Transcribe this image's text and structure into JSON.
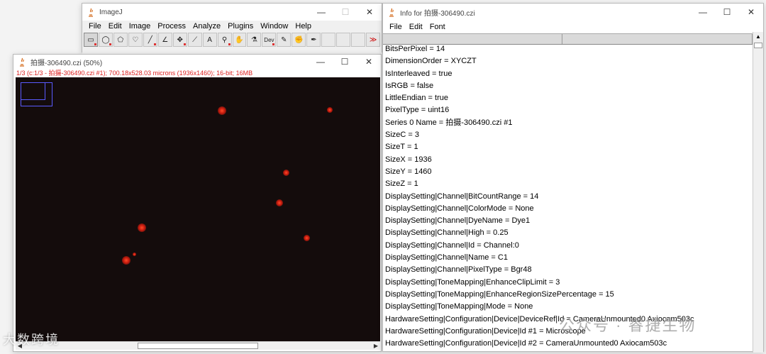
{
  "imagej": {
    "title": "ImageJ",
    "menus": [
      "File",
      "Edit",
      "Image",
      "Process",
      "Analyze",
      "Plugins",
      "Window",
      "Help"
    ],
    "tools": [
      {
        "name": "rectangle-tool-icon",
        "glyph": "▭",
        "selected": true,
        "flag": true
      },
      {
        "name": "oval-tool-icon",
        "glyph": "◯",
        "flag": true
      },
      {
        "name": "polygon-tool-icon",
        "glyph": "⬠",
        "flag": false
      },
      {
        "name": "freehand-tool-icon",
        "glyph": "♡",
        "flag": false
      },
      {
        "name": "line-tool-icon",
        "glyph": "╱",
        "flag": true
      },
      {
        "name": "angle-tool-icon",
        "glyph": "∠",
        "flag": false
      },
      {
        "name": "point-tool-icon",
        "glyph": "✥",
        "flag": true
      },
      {
        "name": "wand-tool-icon",
        "glyph": "⟋",
        "flag": false
      },
      {
        "name": "text-tool-icon",
        "glyph": "A",
        "flag": false
      },
      {
        "name": "magnifier-tool-icon",
        "glyph": "⚲",
        "flag": true
      },
      {
        "name": "hand-tool-icon",
        "glyph": "✋",
        "flag": false
      },
      {
        "name": "dropper-tool-icon",
        "glyph": "⚗",
        "flag": false
      },
      {
        "name": "dev-tool-icon",
        "glyph": "Dev",
        "flag": true
      },
      {
        "name": "brush-tool-icon",
        "glyph": "✎",
        "flag": false
      },
      {
        "name": "flood-fill-tool-icon",
        "glyph": "✊",
        "flag": false
      },
      {
        "name": "pencil-tool-icon",
        "glyph": "✒",
        "flag": false
      },
      {
        "name": "empty-tool-slot",
        "glyph": "",
        "flag": false
      },
      {
        "name": "empty-tool-slot",
        "glyph": "",
        "flag": false
      },
      {
        "name": "empty-tool-slot",
        "glyph": "",
        "flag": false
      },
      {
        "name": "more-tools-icon",
        "glyph": "≫",
        "flag": false
      }
    ]
  },
  "image_window": {
    "title": "拍摄-306490.czi (50%)",
    "info": "1/3 (c:1/3 - 拍摄-306490.czi #1); 700.18x528.03 microns (1936x1460); 16-bit; 16MB"
  },
  "info_window": {
    "title": "Info for 拍摄-306490.czi",
    "menus": [
      "File",
      "Edit",
      "Font"
    ],
    "lines": [
      " BitsPerPixel = 14",
      " DimensionOrder = XYCZT",
      " IsInterleaved = true",
      " IsRGB = false",
      " LittleEndian = true",
      " PixelType = uint16",
      " Series 0 Name = 拍摄-306490.czi #1",
      " SizeC = 3",
      " SizeT = 1",
      " SizeX = 1936",
      " SizeY = 1460",
      " SizeZ = 1",
      "DisplaySetting|Channel|BitCountRange = 14",
      "DisplaySetting|Channel|ColorMode = None",
      "DisplaySetting|Channel|DyeName = Dye1",
      "DisplaySetting|Channel|High = 0.25",
      "DisplaySetting|Channel|Id = Channel:0",
      "DisplaySetting|Channel|Name = C1",
      "DisplaySetting|Channel|PixelType = Bgr48",
      "DisplaySetting|ToneMapping|EnhanceClipLimit = 3",
      "DisplaySetting|ToneMapping|EnhanceRegionSizePercentage = 15",
      "DisplaySetting|ToneMapping|Mode = None",
      "HardwareSetting|Configuration|Device|DeviceRef|Id = CameraUnmounted0 Axiocam503c",
      "HardwareSetting|Configuration|Device|Id #1 = Microscope",
      "HardwareSetting|Configuration|Device|Id #2 = CameraUnmounted0 Axiocam503c"
    ]
  },
  "watermarks": {
    "left": "大数跨境",
    "right": "公众号 · 睿捷生物"
  }
}
